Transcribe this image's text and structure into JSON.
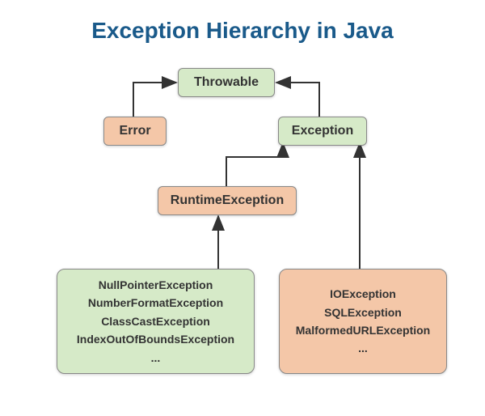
{
  "title": "Exception Hierarchy in Java",
  "nodes": {
    "throwable": "Throwable",
    "error": "Error",
    "exception": "Exception",
    "runtime": "RuntimeException"
  },
  "runtime_list": {
    "i0": "NullPointerException",
    "i1": "NumberFormatException",
    "i2": "ClassCastException",
    "i3": "IndexOutOfBoundsException",
    "i4": "..."
  },
  "checked_list": {
    "i0": "IOException",
    "i1": "SQLException",
    "i2": "MalformedURLException",
    "i3": "..."
  }
}
